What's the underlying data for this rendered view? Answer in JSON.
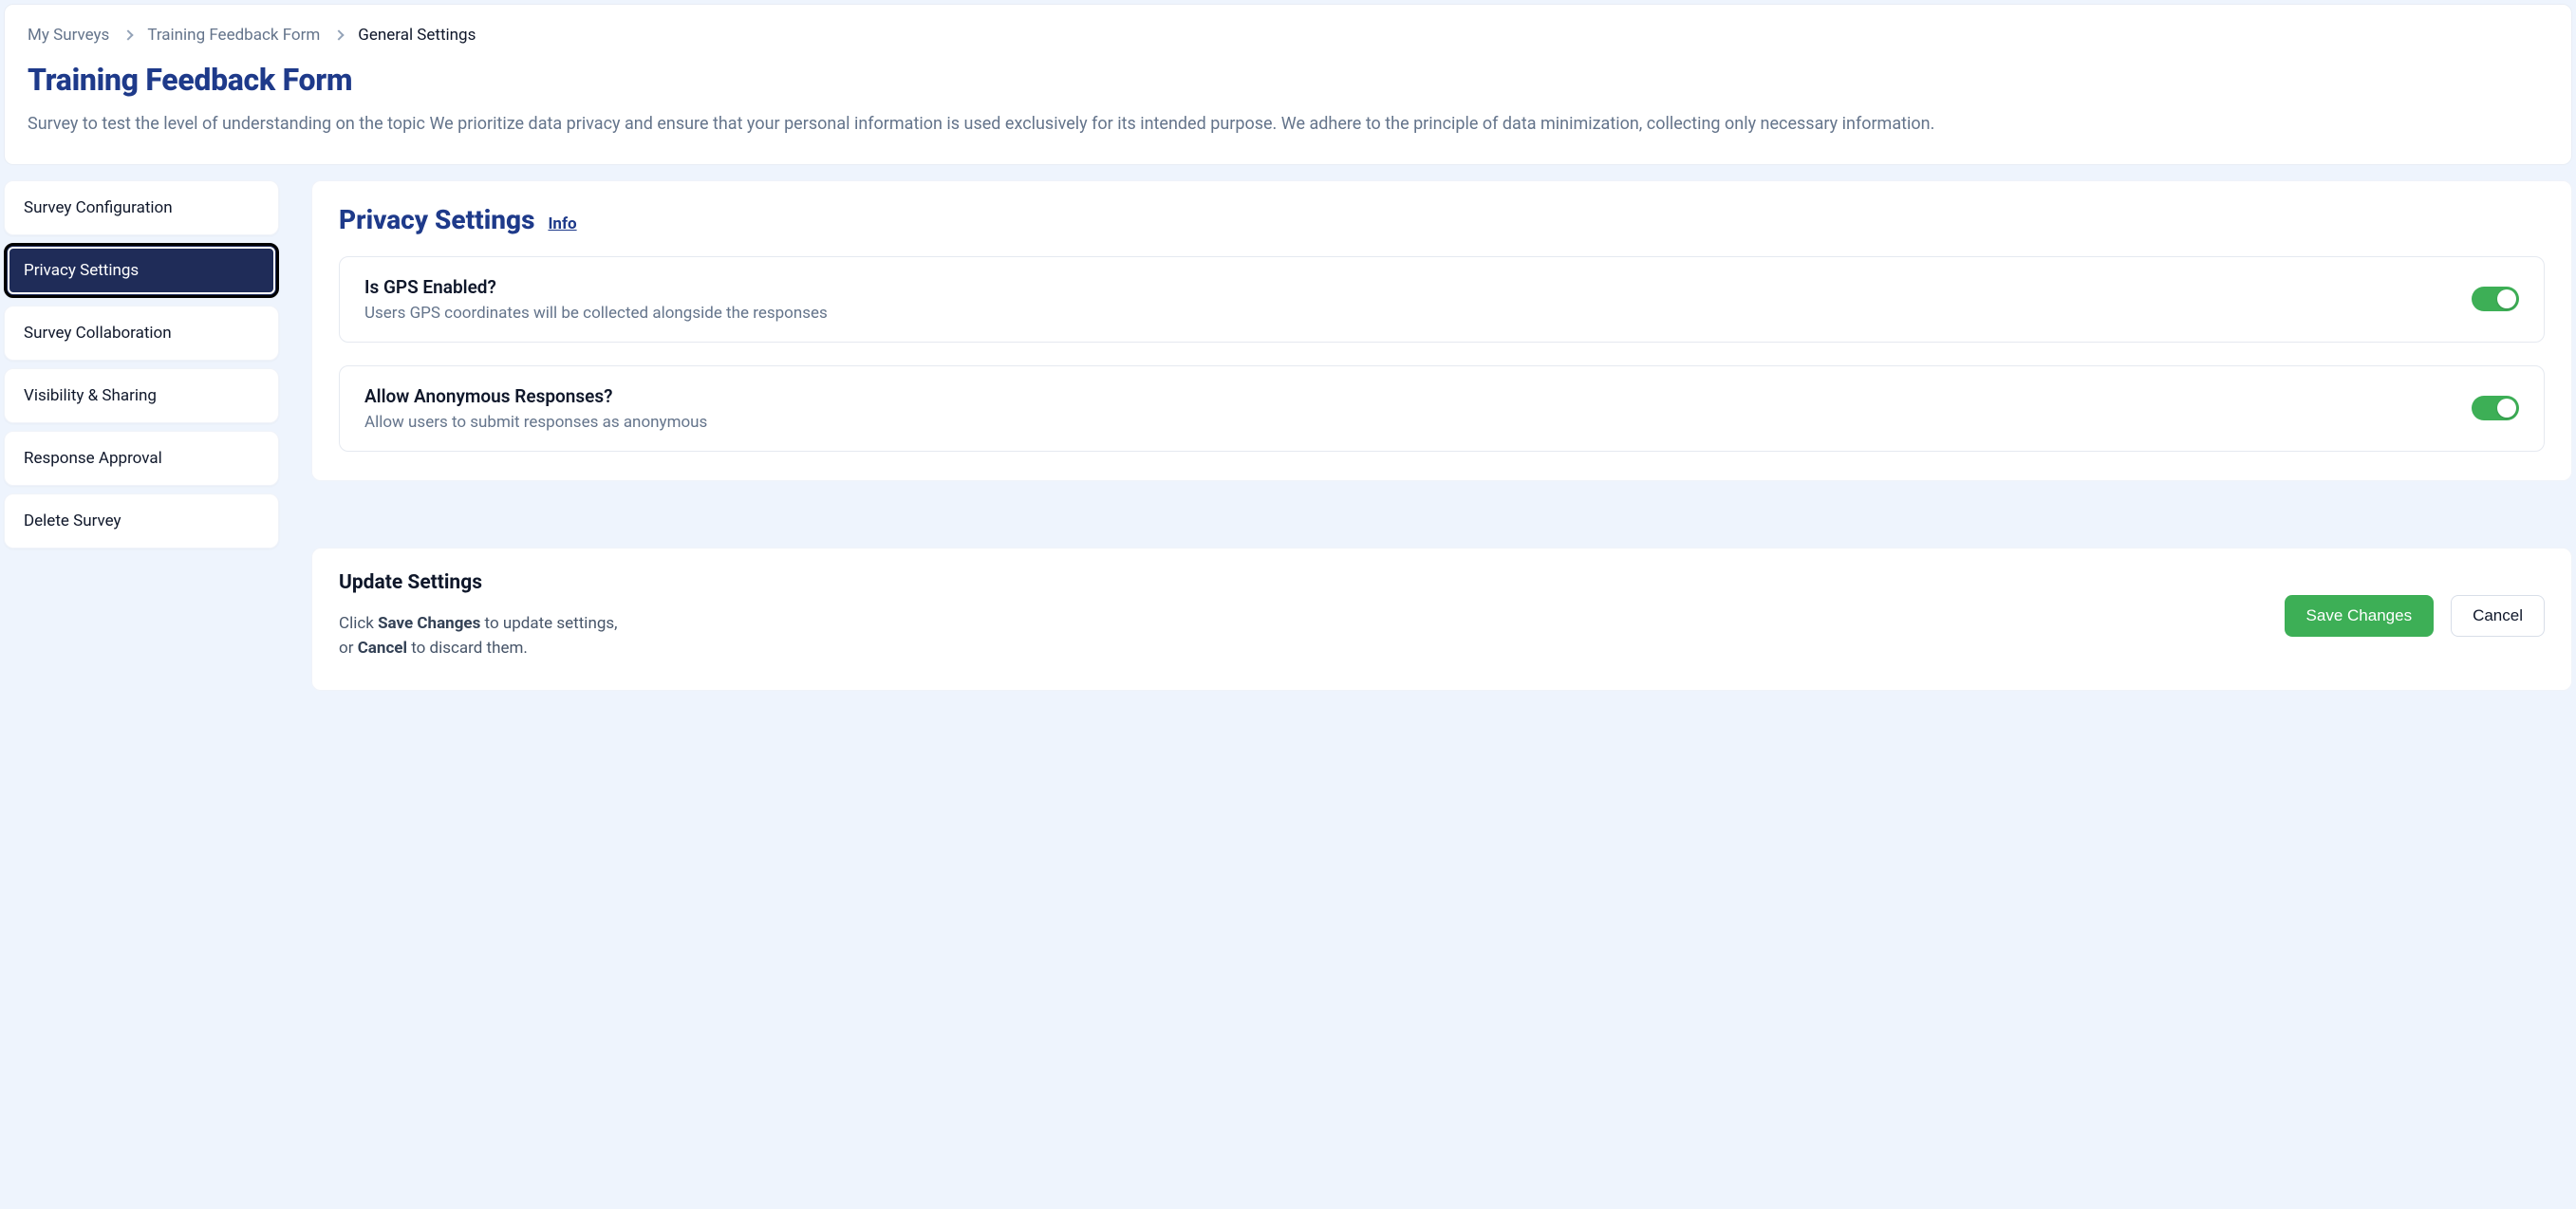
{
  "breadcrumb": {
    "items": [
      {
        "label": "My Surveys",
        "current": false
      },
      {
        "label": "Training Feedback Form",
        "current": false
      },
      {
        "label": "General Settings",
        "current": true
      }
    ]
  },
  "header": {
    "title": "Training Feedback Form",
    "description": "Survey to test the level of understanding on the topic We prioritize data privacy and ensure that your personal information is used exclusively for its intended purpose. We adhere to the principle of data minimization, collecting only necessary information."
  },
  "sidebar": {
    "items": [
      {
        "label": "Survey Configuration",
        "active": false
      },
      {
        "label": "Privacy Settings",
        "active": true
      },
      {
        "label": "Survey Collaboration",
        "active": false
      },
      {
        "label": "Visibility & Sharing",
        "active": false
      },
      {
        "label": "Response Approval",
        "active": false
      },
      {
        "label": "Delete Survey",
        "active": false
      }
    ]
  },
  "panel": {
    "title": "Privacy Settings",
    "info_label": "Info",
    "settings": [
      {
        "title": "Is GPS Enabled?",
        "desc": "Users GPS coordinates will be collected alongside the responses",
        "enabled": true
      },
      {
        "title": "Allow Anonymous Responses?",
        "desc": "Allow users to submit responses as anonymous",
        "enabled": true
      }
    ]
  },
  "update": {
    "title": "Update Settings",
    "text_prefix": "Click ",
    "save_strong": "Save Changes",
    "text_mid": " to update settings,",
    "text_or": "or ",
    "cancel_strong": "Cancel",
    "text_suffix": " to discard them.",
    "save_label": "Save Changes",
    "cancel_label": "Cancel"
  }
}
